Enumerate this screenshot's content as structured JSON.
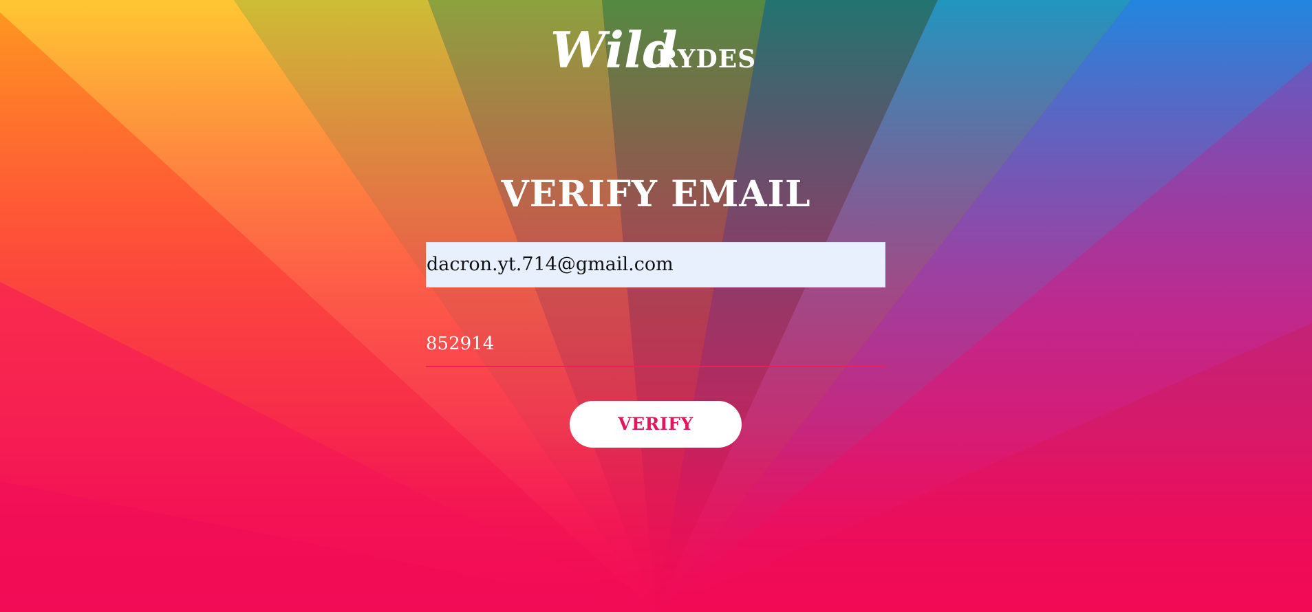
{
  "brand": {
    "logo_script": "Wild",
    "logo_caps": "RYDES"
  },
  "page": {
    "title": "VERIFY EMAIL"
  },
  "form": {
    "email_value": "dacron.yt.714@gmail.com",
    "code_value": "852914",
    "verify_label": "VERIFY"
  },
  "colors": {
    "button_text": "#e4135a",
    "underline": "#ee1f58",
    "autofill_bg": "#e8f0fe"
  }
}
